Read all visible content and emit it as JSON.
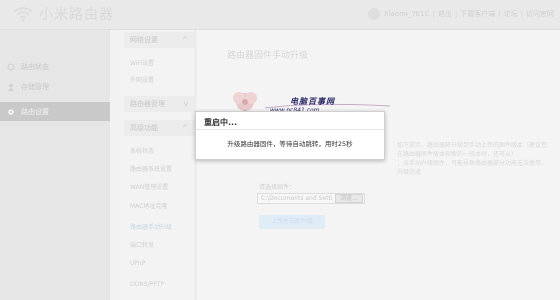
{
  "header": {
    "app_title": "小米路由器",
    "username": "Xiaomi_7E1C",
    "links": [
      "退出",
      "下载客户端",
      "论坛",
      "访问官网"
    ]
  },
  "sidebar": {
    "items": [
      {
        "label": "路由状态",
        "icon": "router-status-icon",
        "active": false
      },
      {
        "label": "存储管理",
        "icon": "user-icon",
        "active": false
      },
      {
        "label": "路由设置",
        "icon": "gear-icon",
        "active": true
      }
    ]
  },
  "submenu": {
    "sections": [
      {
        "title": "网络设置",
        "items": [
          "WiFi设置",
          "外网设置"
        ]
      },
      {
        "title": "路由器管理",
        "items": []
      },
      {
        "title": "高级功能",
        "items": [
          "系统状态",
          "路由器系统设置",
          "WAN管理设置",
          "MAC地址克隆",
          "路由器手动升级",
          "端口转发",
          "UPnP",
          "DDNS/PPTP"
        ]
      }
    ]
  },
  "main": {
    "title": "路由器固件手动升级",
    "note1": "如下提示，路由器将升级到手动上传的固件版本（建议您在路由器固件版本较新的一版本时，还可以）",
    "note2": "，当手动升级固件，可能导致路由器部分功能无法使用，升级完成",
    "select_label": "请选择固件：",
    "file_path": "C:\\Documents and Setti",
    "browse_label": "浏览...",
    "upgrade_button": "上传并立即升级"
  },
  "dialog": {
    "title": "重启中...",
    "message": "升级路由器固件，等待自动跳转，用时25秒"
  },
  "watermark": {
    "text": "电脑百事网",
    "url": "www.pc841.com"
  },
  "colors": {
    "active_sidebar": "#c9c9c9",
    "button_blue": "#e0ecf6",
    "dialog_text": "#333333"
  }
}
